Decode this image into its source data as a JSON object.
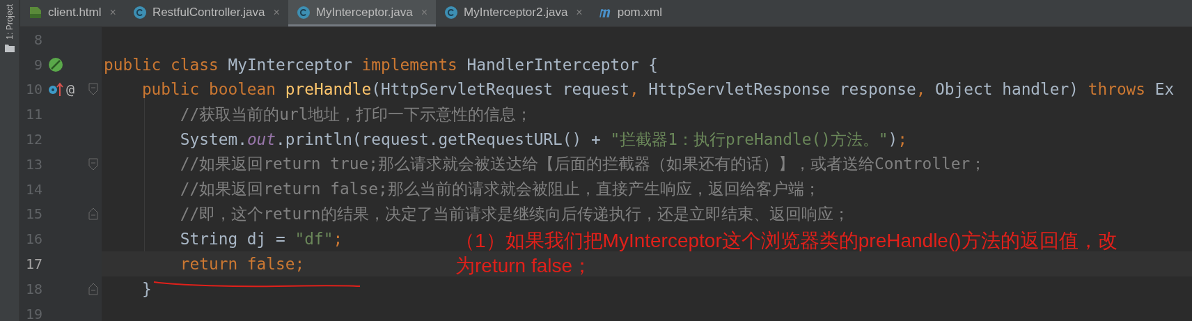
{
  "project_tool": {
    "label": "1: Project"
  },
  "tabs": [
    {
      "label": "client.html",
      "kind": "html",
      "selected": false,
      "close": "×"
    },
    {
      "label": "RestfulController.java",
      "kind": "class",
      "selected": false,
      "close": "×"
    },
    {
      "label": "MyInterceptor.java",
      "kind": "class",
      "selected": true,
      "close": "×"
    },
    {
      "label": "MyInterceptor2.java",
      "kind": "class",
      "selected": false,
      "close": "×"
    },
    {
      "label": "pom.xml",
      "kind": "maven",
      "selected": false
    }
  ],
  "editor": {
    "lines": [
      {
        "number": "8",
        "current": false
      },
      {
        "number": "9",
        "current": false,
        "gutter": [
          {
            "kind": "bean"
          }
        ],
        "tokens": [
          {
            "kind": "kw",
            "s": "public class "
          },
          {
            "kind": "plain",
            "s": "MyInterceptor "
          },
          {
            "kind": "kw",
            "s": "implements "
          },
          {
            "kind": "plain",
            "s": "HandlerInterceptor {"
          }
        ]
      },
      {
        "number": "10",
        "current": false,
        "gutter": [
          {
            "kind": "override"
          },
          {
            "kind": "glyph",
            "s": "@"
          }
        ],
        "fold": {
          "kind": "start"
        },
        "tokens": [
          {
            "kind": "kw",
            "s": "    public boolean "
          },
          {
            "kind": "method",
            "s": "preHandle"
          },
          {
            "kind": "plain",
            "s": "(HttpServletRequest request"
          },
          {
            "kind": "kw",
            "s": ","
          },
          {
            "kind": "plain",
            "s": " HttpServletResponse response"
          },
          {
            "kind": "kw",
            "s": ","
          },
          {
            "kind": "plain",
            "s": " Object handler) "
          },
          {
            "kind": "kw",
            "s": "throws "
          },
          {
            "kind": "plain",
            "s": "Ex"
          }
        ]
      },
      {
        "number": "11",
        "current": false,
        "tokens": [
          {
            "kind": "comment",
            "s": "        //获取当前的url地址，打印一下示意性的信息；"
          }
        ]
      },
      {
        "number": "12",
        "current": false,
        "tokens": [
          {
            "kind": "plain",
            "s": "        System."
          },
          {
            "kind": "field",
            "s": "out"
          },
          {
            "kind": "plain",
            "s": ".println(request.getRequestURL() + "
          },
          {
            "kind": "string",
            "s": "\"拦截器1：执行preHandle()方法。\""
          },
          {
            "kind": "plain",
            "s": ")"
          },
          {
            "kind": "kw",
            "s": ";"
          }
        ]
      },
      {
        "number": "13",
        "current": false,
        "fold": {
          "kind": "start"
        },
        "tokens": [
          {
            "kind": "comment",
            "s": "        //如果返回return true;那么请求就会被送达给【后面的拦截器（如果还有的话）】，或者送给Controller；"
          }
        ]
      },
      {
        "number": "14",
        "current": false,
        "tokens": [
          {
            "kind": "comment",
            "s": "        //如果返回return false;那么当前的请求就会被阻止，直接产生响应，返回给客户端；"
          }
        ]
      },
      {
        "number": "15",
        "current": false,
        "fold": {
          "kind": "end"
        },
        "tokens": [
          {
            "kind": "comment",
            "s": "        //即，这个return的结果，决定了当前请求是继续向后传递执行，还是立即结束、返回响应；"
          }
        ]
      },
      {
        "number": "16",
        "current": false,
        "tokens": [
          {
            "kind": "plain",
            "s": "        String dj = "
          },
          {
            "kind": "string",
            "s": "\"df\""
          },
          {
            "kind": "kw",
            "s": ";"
          }
        ]
      },
      {
        "number": "17",
        "current": true,
        "tokens": [
          {
            "kind": "kw",
            "s": "        return false;"
          }
        ]
      },
      {
        "number": "18",
        "current": false,
        "fold": {
          "kind": "end"
        },
        "tokens": [
          {
            "kind": "plain",
            "s": "    }"
          }
        ]
      },
      {
        "number": "19",
        "current": false
      }
    ]
  },
  "annotation": {
    "text": "（1）如果我们把MyInterceptor这个浏览器类的preHandle()方法的返回值，改为return false；"
  }
}
